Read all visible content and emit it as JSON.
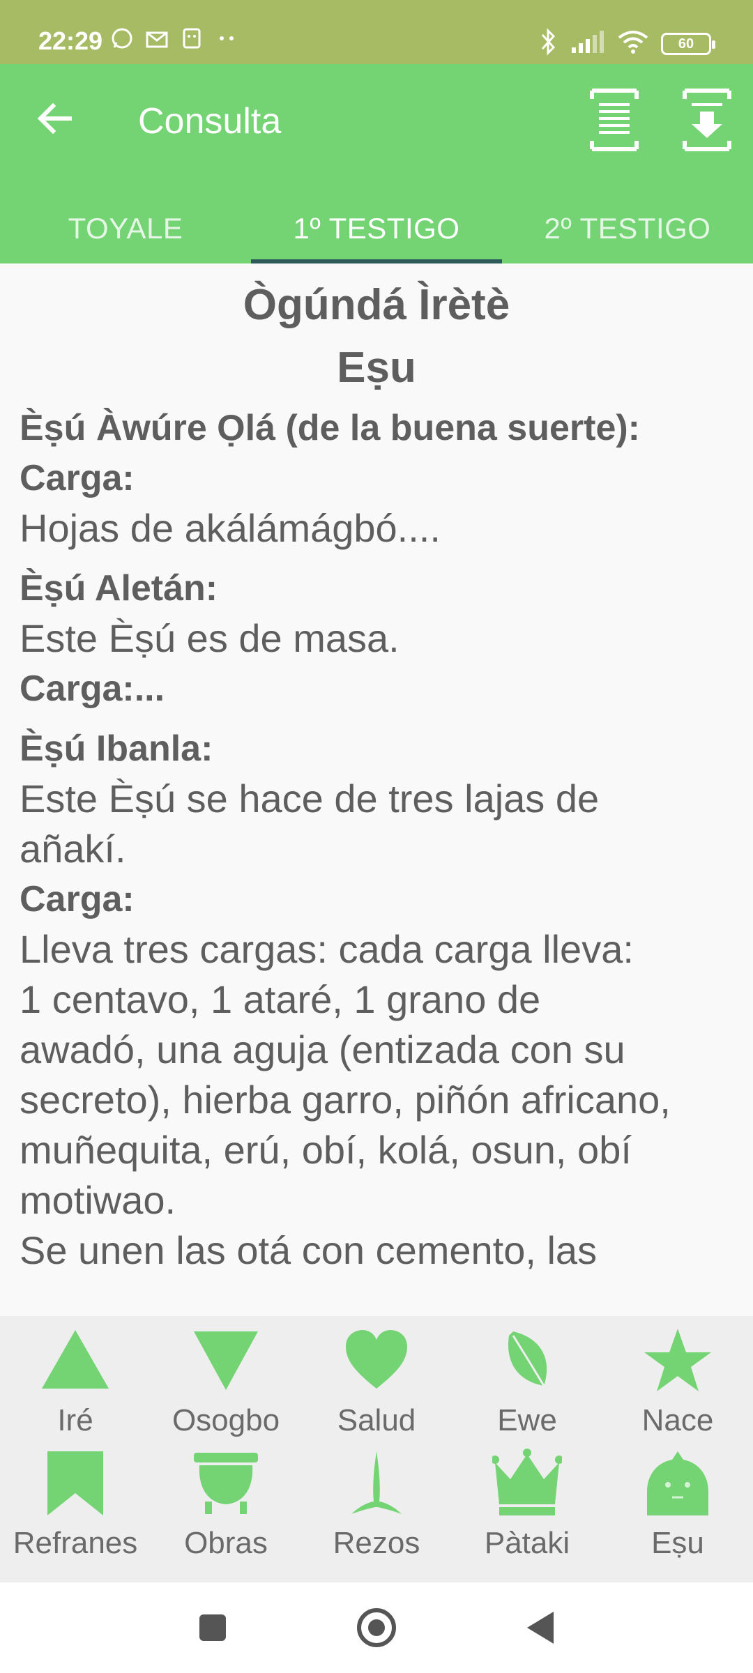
{
  "status": {
    "time": "22:29",
    "battery": "60"
  },
  "header": {
    "title": "Consulta",
    "tabs": [
      "TOYALE",
      "1º TESTIGO",
      "2º TESTIGO"
    ],
    "active_tab": 1
  },
  "content": {
    "title": "Ògúndá Ìrètè",
    "subtitle": "Eṣu",
    "lines": [
      {
        "style": "b",
        "text": "Èṣú Àwúre Ọlá (de la buena suerte):"
      },
      {
        "style": "b",
        "text": "Carga:"
      },
      {
        "style": "t",
        "text": "Hojas de akálámágbó...."
      },
      {
        "style": "gap",
        "text": ""
      },
      {
        "style": "b",
        "text": "Èṣú Aletán:"
      },
      {
        "style": "t",
        "text": "Este Èṣú es de masa."
      },
      {
        "style": "b",
        "text": "Carga:..."
      },
      {
        "style": "gap",
        "text": ""
      },
      {
        "style": "b",
        "text": "Èṣú Ibanla:"
      },
      {
        "style": "t",
        "text": "Este Èṣú se hace de tres lajas de"
      },
      {
        "style": "t",
        "text": "añakí."
      },
      {
        "style": "b",
        "text": "Carga:"
      },
      {
        "style": "t",
        "text": "Lleva tres cargas: cada carga lleva:"
      },
      {
        "style": "t",
        "text": "1 centavo, 1 ataré, 1 grano de"
      },
      {
        "style": "t",
        "text": "awadó, una aguja (entizada con su"
      },
      {
        "style": "t",
        "text": "secreto), hierba garro, piñón africano,"
      },
      {
        "style": "t",
        "text": "muñequita, erú, obí, kolá, osun, obí"
      },
      {
        "style": "t",
        "text": "motiwao."
      },
      {
        "style": "t",
        "text": "Se unen las otá con cemento, las"
      }
    ]
  },
  "menu": {
    "row1": [
      {
        "label": "Iré",
        "icon": "triangle-up-icon"
      },
      {
        "label": "Osogbo",
        "icon": "triangle-down-icon"
      },
      {
        "label": "Salud",
        "icon": "heart-icon"
      },
      {
        "label": "Ewe",
        "icon": "leaf-icon"
      },
      {
        "label": "Nace",
        "icon": "star-icon"
      }
    ],
    "row2": [
      {
        "label": "Refranes",
        "icon": "bookmark-icon"
      },
      {
        "label": "Obras",
        "icon": "cauldron-icon"
      },
      {
        "label": "Rezos",
        "icon": "plant-icon"
      },
      {
        "label": "Pàtaki",
        "icon": "crown-icon"
      },
      {
        "label": "Eṣu",
        "icon": "eshu-head-icon"
      }
    ],
    "accent": "#74d474"
  },
  "colors": {
    "status_bar": "#a6bb63",
    "app_bar": "#74d474",
    "tab_indicator": "#2e5b5a",
    "text": "#5e5e5e"
  }
}
